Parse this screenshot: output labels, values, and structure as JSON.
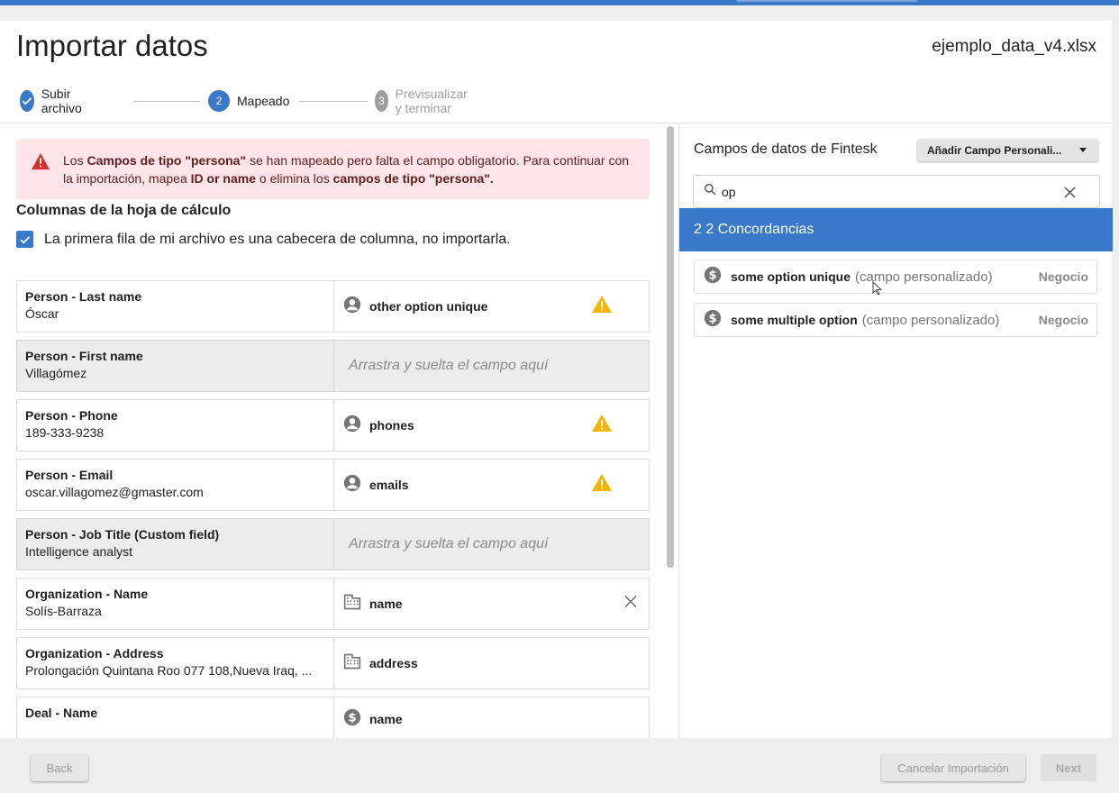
{
  "page": {
    "title": "Importar datos",
    "filename": "ejemplo_data_v4.xlsx"
  },
  "stepper": [
    {
      "num": "",
      "label": "Subir archivo",
      "state": "done"
    },
    {
      "num": "2",
      "label": "Mapeado",
      "state": "active"
    },
    {
      "num": "3",
      "label": "Previsualizar y terminar",
      "state": "todo"
    }
  ],
  "alert": {
    "p1": "Los ",
    "b1": "Campos de tipo \"persona\"",
    "p2": " se han mapeado pero falta el campo obligatorio. Para continuar con la importación, mapea ",
    "b2": "ID or name",
    "p3": " o elimina los ",
    "b3": "campos de tipo \"persona\".",
    "icon": "warning-triangle-icon",
    "color": "#d32f2f"
  },
  "columns": {
    "title": "Columnas de la hoja de cálculo",
    "header_checkbox_label": "La primera fila de mi archivo es una cabecera de columna, no importarla.",
    "drop_placeholder": "Arrastra y suelta el campo aquí",
    "rows": [
      {
        "header": "Person - Last name",
        "value": "Óscar",
        "field": "other option unique",
        "icon": "person-icon",
        "warning": true
      },
      {
        "header": "Person - First name",
        "value": "Villagómez",
        "field": ""
      },
      {
        "header": "Person - Phone",
        "value": "189-333-9238",
        "field": "phones",
        "icon": "person-icon",
        "warning": true
      },
      {
        "header": "Person - Email",
        "value": "oscar.villagomez@gmaster.com",
        "field": "emails",
        "icon": "person-icon",
        "warning": true
      },
      {
        "header": "Person - Job Title (Custom field)",
        "value": "Intelligence analyst",
        "field": ""
      },
      {
        "header": "Organization - Name",
        "value": "Solís-Barraza",
        "field": "name",
        "icon": "building-icon",
        "removable": true
      },
      {
        "header": "Organization - Address",
        "value": "Prolongación Quintana Roo 077 108,Nueva Iraq, ...",
        "field": "address",
        "icon": "building-icon"
      },
      {
        "header": "Deal - Name",
        "value": "",
        "field": "name",
        "icon": "dollar-icon"
      }
    ]
  },
  "fields_panel": {
    "title": "Campos de datos de Fintesk",
    "add_button": "Añadir Campo Personali...",
    "search_value": "op",
    "matches_label": "2 2 Concordancias",
    "results": [
      {
        "name": "some option unique",
        "kind": "(campo personalizado)",
        "tag": "Negocio",
        "icon": "dollar-icon"
      },
      {
        "name": "some multiple option",
        "kind": "(campo personalizado)",
        "tag": "Negocio",
        "icon": "dollar-icon"
      }
    ]
  },
  "footer": {
    "back": "Back",
    "cancel": "Cancelar Importación",
    "next": "Next"
  },
  "colors": {
    "accent": "#3a78c9",
    "warning": "#f4b400",
    "alert_bg": "#fce4e8"
  }
}
